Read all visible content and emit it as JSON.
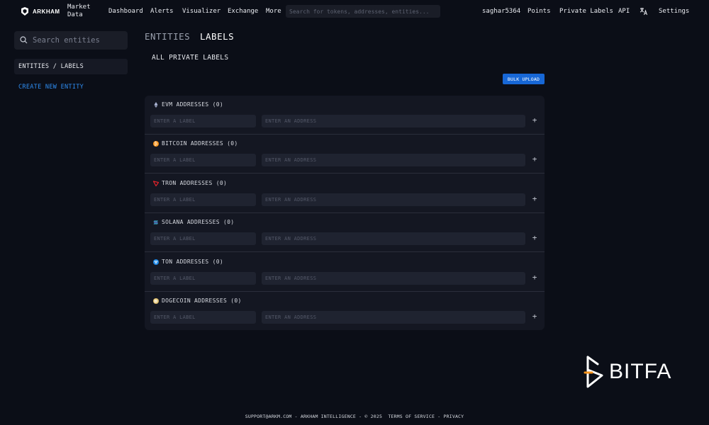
{
  "app": {
    "logo_text": "ARKHAM"
  },
  "nav": {
    "market_data": "Market Data",
    "dashboard": "Dashboard",
    "alerts": "Alerts",
    "visualizer": "Visualizer",
    "exchange": "Exchange",
    "more": "More",
    "search_placeholder": "Search for tokens, addresses, entities...",
    "username": "saghar5364",
    "points": "Points",
    "private_labels": "Private Labels",
    "api": "API",
    "settings": "Settings"
  },
  "sidebar": {
    "search_placeholder": "Search entities",
    "active_item": "ENTITIES / LABELS",
    "create_link": "CREATE NEW ENTITY"
  },
  "main": {
    "tabs": [
      {
        "label": "ENTITIES",
        "active": false
      },
      {
        "label": "LABELS",
        "active": true
      }
    ],
    "heading": "ALL PRIVATE LABELS",
    "bulk_upload": "BULK UPLOAD",
    "label_placeholder": "ENTER A LABEL",
    "address_placeholder": "ENTER AN ADDRESS",
    "add_symbol": "+",
    "chains": [
      {
        "title": "EVM ADDRESSES (0)",
        "icon": "ethereum-icon",
        "color": "#aab4d4"
      },
      {
        "title": "BITCOIN ADDRESSES (0)",
        "icon": "bitcoin-icon",
        "color": "#f7931a"
      },
      {
        "title": "TRON ADDRESSES (0)",
        "icon": "tron-icon",
        "color": "#e0232a"
      },
      {
        "title": "SOLANA ADDRESSES (0)",
        "icon": "solana-icon",
        "color": "#3fb8e0"
      },
      {
        "title": "TON ADDRESSES (0)",
        "icon": "ton-icon",
        "color": "#1e88e5"
      },
      {
        "title": "DOGECOIN ADDRESSES (0)",
        "icon": "dogecoin-icon",
        "color": "#e0c070"
      }
    ]
  },
  "watermark": {
    "text": "BITFA",
    "accent": "#f7931a"
  },
  "footer": {
    "email": "SUPPORT@ARKM.COM",
    "sep1": " - ",
    "company": "ARKHAM INTELLIGENCE",
    "sep2": " - ",
    "copyright": "© 2025",
    "terms": "TERMS OF SERVICE",
    "sep3": " - ",
    "privacy": "PRIVACY"
  }
}
